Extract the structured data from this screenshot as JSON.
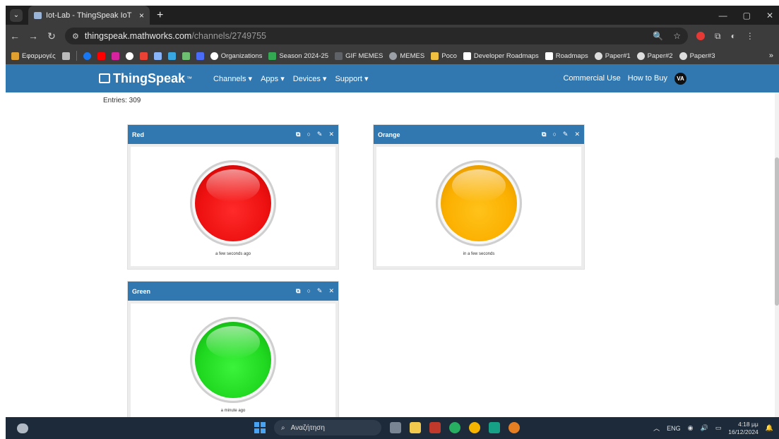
{
  "browser": {
    "tab_title": "Iot-Lab - ThingSpeak IoT",
    "tab_close": "×",
    "new_tab": "+",
    "window_minimize": "—",
    "window_restore": "▢",
    "window_close": "✕",
    "url_host": "thingspeak.mathworks.com",
    "url_path": "/channels/2749755"
  },
  "bookmarks": {
    "apps_label": "Εφαρμογές",
    "items": [
      "Organizations",
      "Season 2024-25",
      "GIF MEMES",
      "MEMES",
      "Poco",
      "Developer Roadmaps",
      "Roadmaps",
      "Paper#1",
      "Paper#2",
      "Paper#3"
    ],
    "more": "»"
  },
  "navbar": {
    "logo_text": "ThingSpeak",
    "logo_tm": "™",
    "menu": [
      "Channels ▾",
      "Apps ▾",
      "Devices ▾",
      "Support ▾"
    ],
    "commercial_use": "Commercial Use",
    "how_to_buy": "How to Buy",
    "avatar_initials": "VA"
  },
  "channel": {
    "entries": "Entries: 309"
  },
  "widgets": [
    {
      "title": "Red",
      "caption": "a few seconds ago",
      "color": "#ee1111"
    },
    {
      "title": "Orange",
      "caption": "in a few seconds",
      "color": "#fbb000"
    },
    {
      "title": "Green",
      "caption": "a minute ago",
      "color": "#20d820"
    }
  ],
  "taskbar": {
    "search_placeholder": "Αναζήτηση",
    "language": "ENG",
    "time": "4:18 μμ",
    "date": "16/12/2024"
  }
}
